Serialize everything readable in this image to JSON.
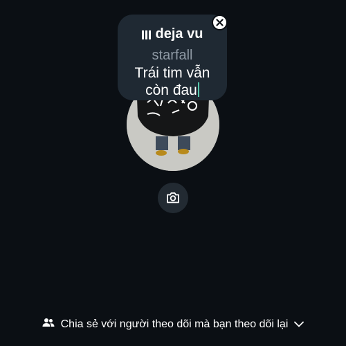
{
  "note_bubble": {
    "song_title": "deja vu",
    "artist": "starfall",
    "note_line1": "Trái tim vẫn",
    "note_line2": "còn đau"
  },
  "share": {
    "label": "Chia sẻ với người theo dõi mà bạn theo dõi lại"
  },
  "icons": {
    "close": "close-icon",
    "camera": "camera-icon",
    "audience": "people-icon",
    "dropdown": "chevron-down-icon",
    "music": "music-bars-icon"
  },
  "colors": {
    "background": "#0b0f14",
    "bubble": "#1f2933",
    "artist_text": "#8e99a4",
    "caret": "#57c7ad"
  }
}
